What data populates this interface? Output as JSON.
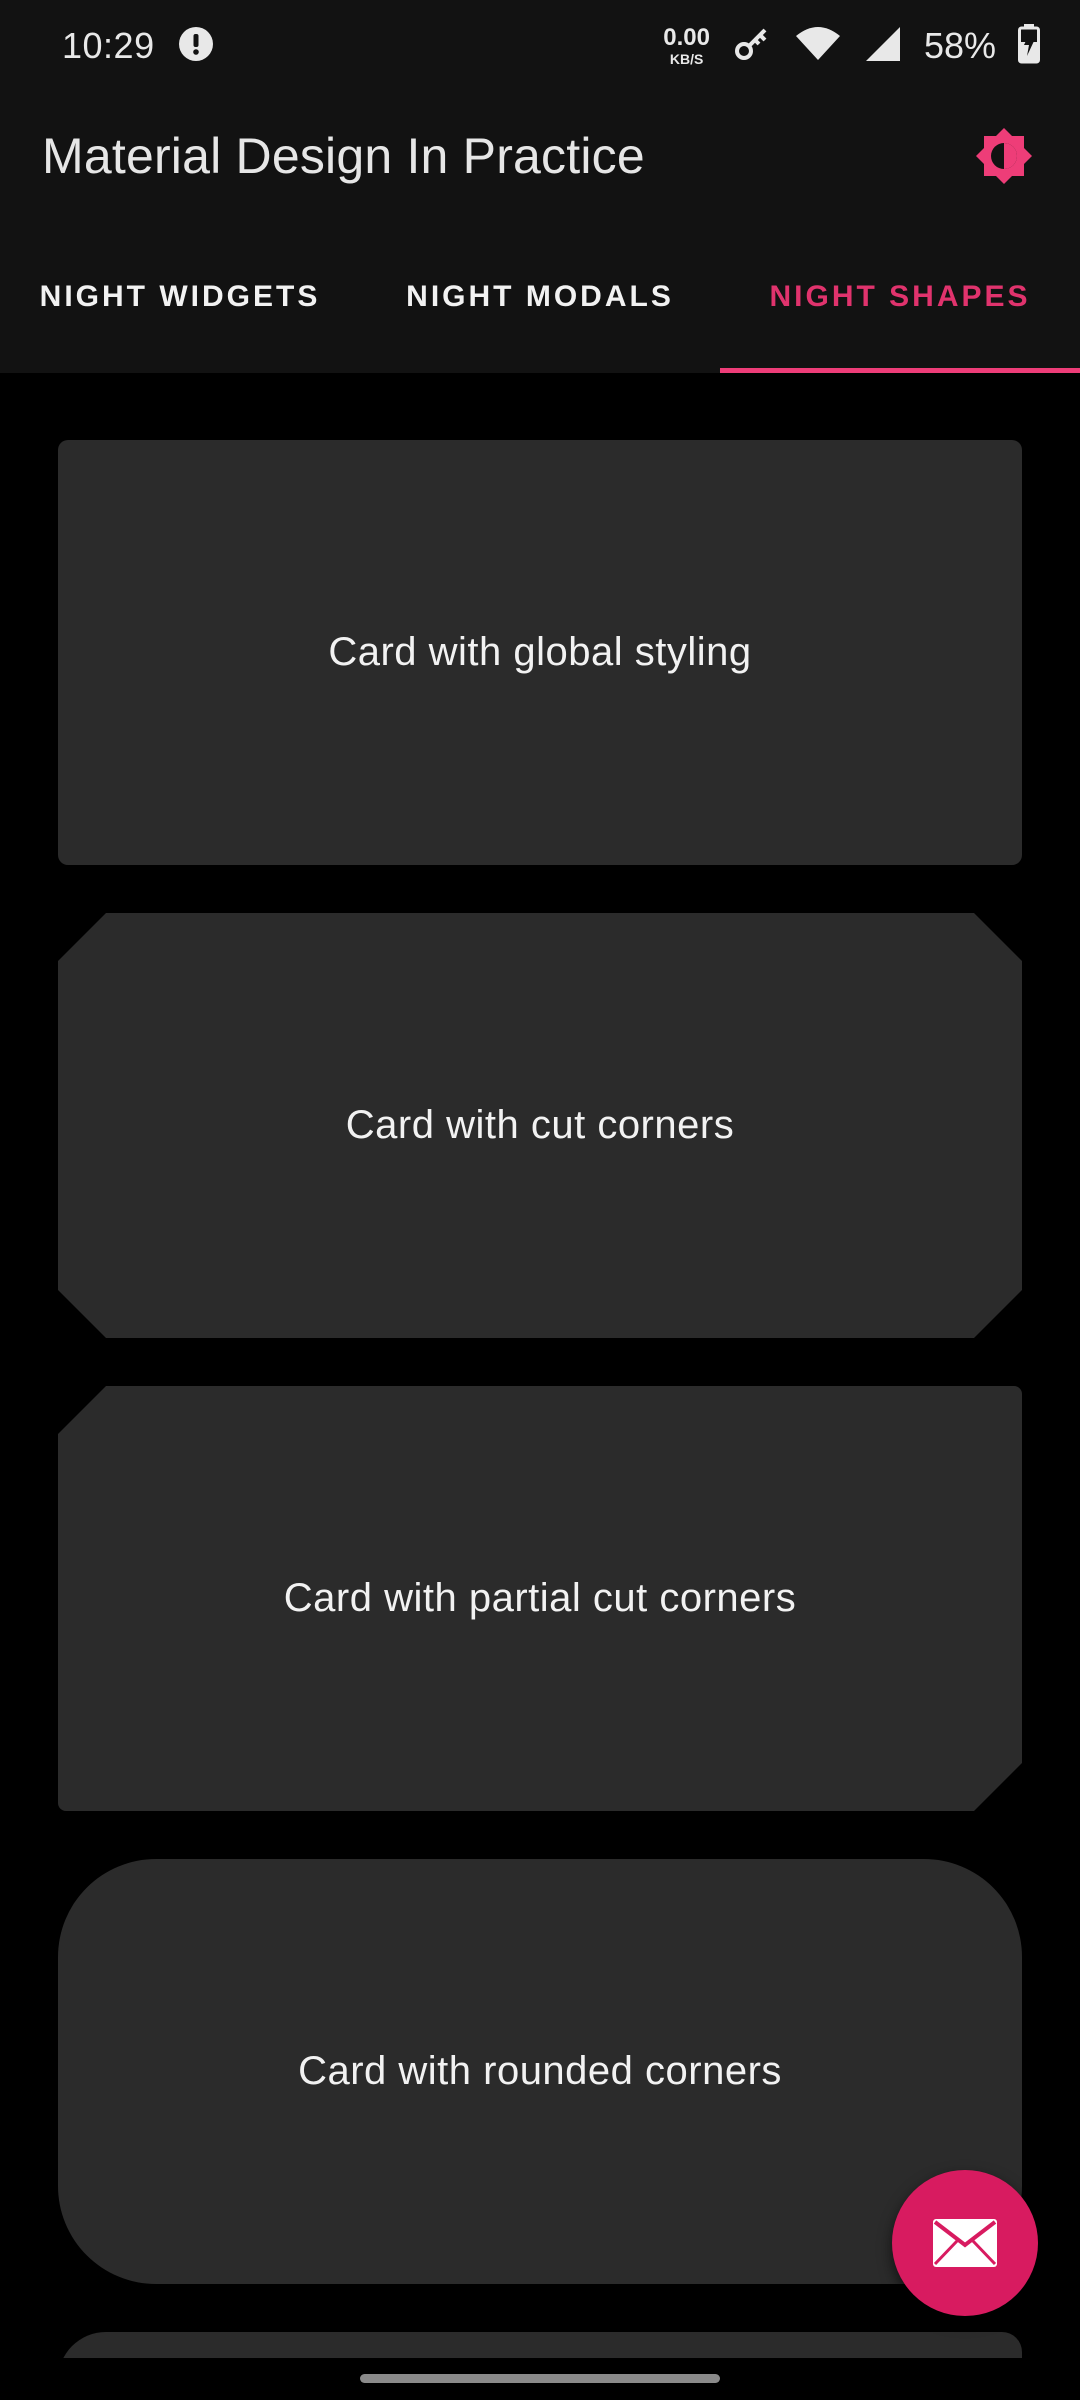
{
  "status_bar": {
    "time": "10:29",
    "net_speed_value": "0.00",
    "net_speed_unit": "KB/S",
    "battery_percent": "58%",
    "icons": [
      "notification-icon",
      "vpn-key-icon",
      "wifi-icon",
      "cell-signal-icon",
      "battery-charging-icon"
    ]
  },
  "app_bar": {
    "title": "Material Design In Practice",
    "action_icon": "brightness-icon",
    "accent_color": "#ee3d78"
  },
  "tabs": [
    {
      "label": "NIGHT WIDGETS",
      "selected": false
    },
    {
      "label": "NIGHT MODALS",
      "selected": false
    },
    {
      "label": "NIGHT SHAPES",
      "selected": true
    }
  ],
  "cards": [
    {
      "label": "Card with global styling"
    },
    {
      "label": "Card with cut corners"
    },
    {
      "label": "Card with partial cut corners"
    },
    {
      "label": "Card with rounded corners"
    }
  ],
  "fab": {
    "icon": "email-icon",
    "color": "#d81b60"
  }
}
